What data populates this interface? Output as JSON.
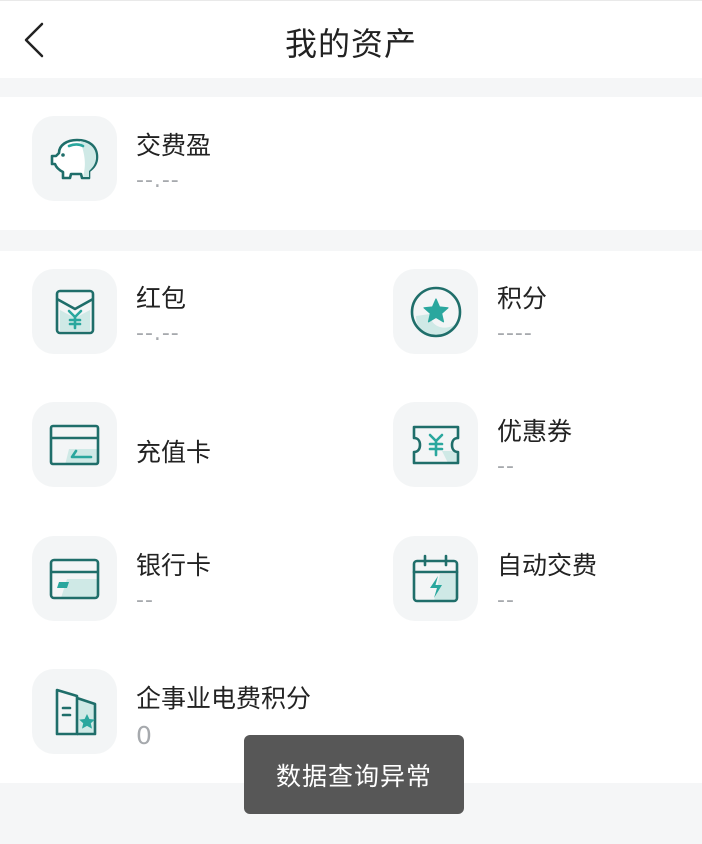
{
  "header": {
    "title": "我的资产",
    "back_icon": "chevron-left-icon"
  },
  "colors": {
    "icon_stroke": "#1f6e6a",
    "icon_accent": "#2aa79e",
    "icon_fill": "#cfe9e6",
    "toast_bg": "#575757"
  },
  "fee_profit": {
    "label": "交费盈",
    "value": "--.--",
    "icon": "piggy-bank-icon"
  },
  "assets": {
    "red_packet": {
      "label": "红包",
      "value": "--.--",
      "icon": "red-envelope-icon"
    },
    "points": {
      "label": "积分",
      "value": "----",
      "icon": "star-badge-icon"
    },
    "recharge_card": {
      "label": "充值卡",
      "value": "",
      "icon": "recharge-card-icon"
    },
    "coupon": {
      "label": "优惠券",
      "value": "--",
      "icon": "coupon-ticket-icon"
    },
    "bank_card": {
      "label": "银行卡",
      "value": "--",
      "icon": "bank-card-icon"
    },
    "auto_pay": {
      "label": "自动交费",
      "value": "--",
      "icon": "calendar-lightning-icon"
    },
    "enterprise_points": {
      "label": "企事业电费积分",
      "value": "0",
      "icon": "building-star-icon"
    }
  },
  "toast": {
    "message": "数据查询异常"
  }
}
